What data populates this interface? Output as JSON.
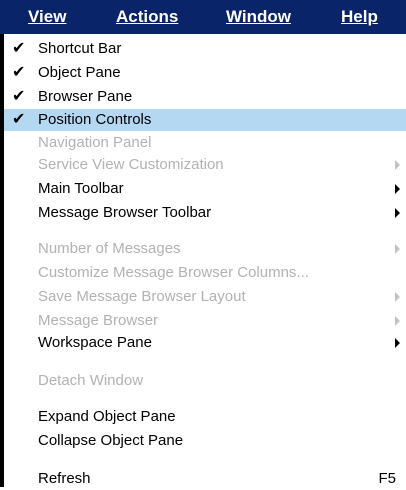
{
  "menubar": {
    "items": [
      "View",
      "Actions",
      "Window",
      "Help"
    ]
  },
  "menu": {
    "check_glyph": "✔",
    "items": [
      {
        "label": "Shortcut Bar",
        "checked": true
      },
      {
        "label": "Object Pane",
        "checked": true
      },
      {
        "label": "Browser Pane",
        "checked": true
      },
      {
        "label": "Position Controls",
        "checked": true,
        "highlighted": true
      },
      {
        "label": "Navigation Panel",
        "disabled": true
      },
      {
        "label": "Service View Customization",
        "disabled": true,
        "submenu": true
      },
      {
        "label": "Main Toolbar",
        "submenu": true
      },
      {
        "label": "Message Browser Toolbar",
        "submenu": true
      },
      {
        "label": "Number of Messages",
        "disabled": true,
        "submenu": true
      },
      {
        "label": "Customize Message Browser Columns...",
        "disabled": true
      },
      {
        "label": "Save Message Browser Layout",
        "disabled": true,
        "submenu": true
      },
      {
        "label": "Message Browser",
        "disabled": true,
        "submenu": true
      },
      {
        "label": "Workspace Pane",
        "submenu": true
      },
      {
        "label": "Detach Window",
        "disabled": true
      },
      {
        "label": "Expand Object Pane"
      },
      {
        "label": "Collapse Object Pane"
      },
      {
        "label": "Refresh",
        "shortcut": "F5"
      }
    ]
  }
}
